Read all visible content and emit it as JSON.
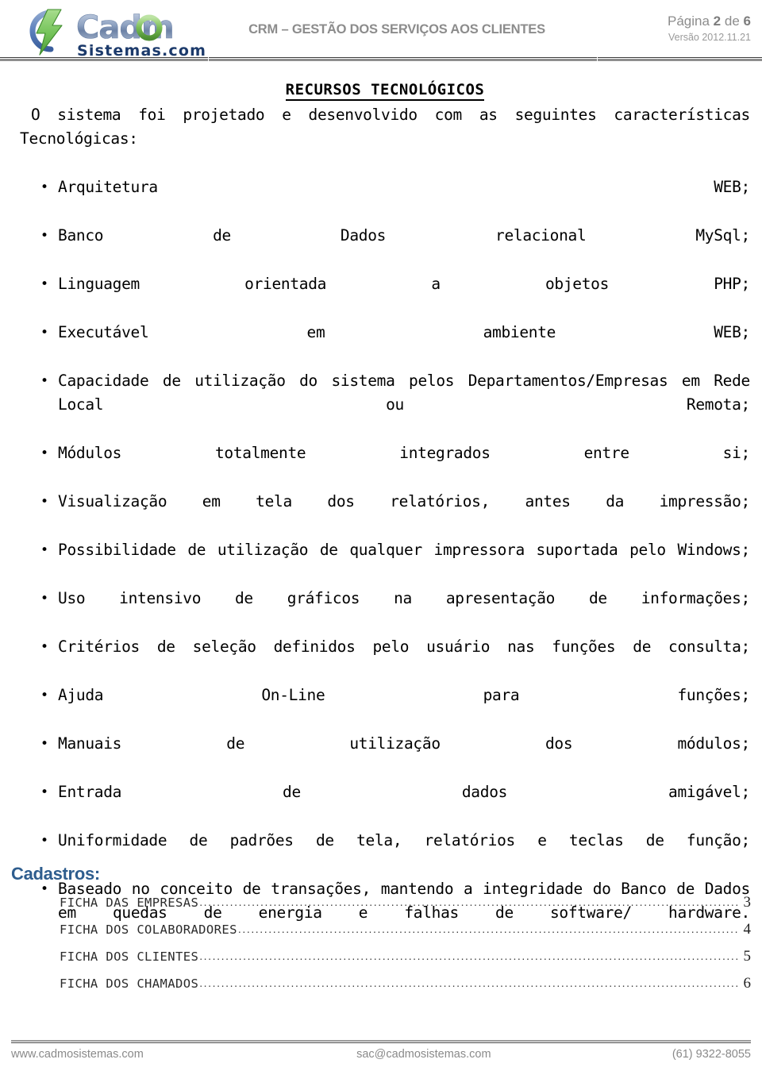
{
  "header": {
    "logo": {
      "icon_name": "cadmo-logo",
      "wordmark": "Cadmo",
      "tagline": "Sistemas.com",
      "bolt_color": "#66c05a",
      "arc_color": "#5b7fbd",
      "wordmark_color": "#7f93b5",
      "tagline_color": "#1c3a6b",
      "o_color": "#6fb84f"
    },
    "title": "CRM – GESTÃO DOS SERVIÇOS AOS CLIENTES",
    "title_color": "#8c8c8c",
    "page_label_prefix": "Página",
    "page_current": "2",
    "page_label_middle": "de",
    "page_total": "6",
    "version": "Versão 2012.11.21"
  },
  "document": {
    "title": "RECURSOS TECNOLÓGICOS",
    "intro": "O sistema foi projetado e desenvolvido com as seguintes características Tecnológicas:",
    "features": [
      "Arquitetura WEB;",
      "Banco de Dados relacional MySql;",
      "Linguagem orientada a objetos PHP;",
      "Executável em ambiente WEB;",
      "Capacidade de utilização do sistema pelos Departamentos/Empresas em Rede Local ou Remota;",
      "Módulos totalmente integrados entre si;",
      "Visualização em tela dos relatórios, antes da impressão;",
      "Possibilidade de utilização de qualquer impressora suportada pelo Windows;",
      "Uso intensivo de gráficos na apresentação de informações;",
      "Critérios de seleção definidos pelo usuário nas funções de consulta;",
      "Ajuda On-Line para funções;",
      "Manuais de utilização dos módulos;",
      "Entrada de dados amigável;",
      "Uniformidade de padrões de tela, relatórios e teclas de função;",
      "Baseado no conceito de transações, mantendo a integridade do Banco de Dados em quedas de energia e falhas de software/ hardware."
    ]
  },
  "toc": {
    "heading": "Cadastros:",
    "heading_color": "#2e5d8e",
    "leader_dots": "............................................................................................................................................................",
    "entries": [
      {
        "label": "FICHA DAS EMPRESAS",
        "page": "3"
      },
      {
        "label": "FICHA DOS COLABORADORES",
        "page": "4"
      },
      {
        "label": "FICHA DOS CLIENTES",
        "page": "5"
      },
      {
        "label": "FICHA DOS CHAMADOS",
        "page": "6"
      }
    ]
  },
  "footer": {
    "website": "www.cadmosistemas.com",
    "email": "sac@cadmosistemas.com",
    "phone": "(61) 9322-8055",
    "text_color": "#8a8a8a"
  }
}
